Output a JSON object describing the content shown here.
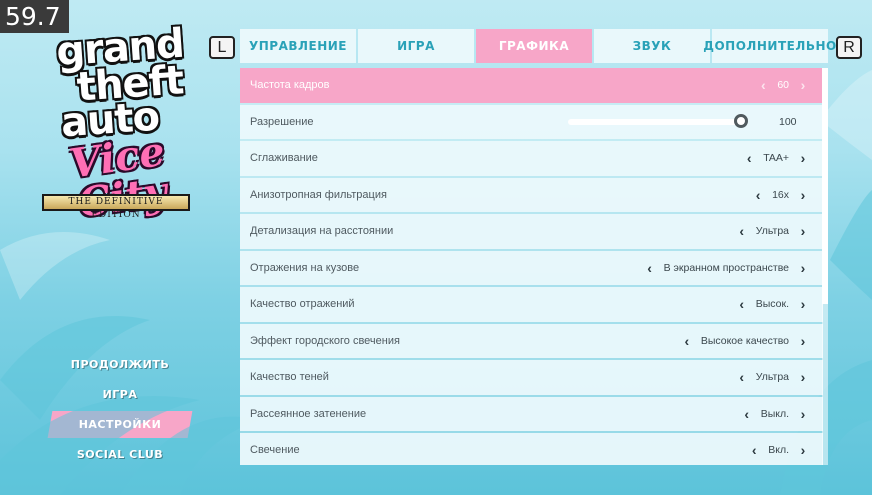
{
  "fps": "59.7",
  "logo": {
    "line1": "grand",
    "line2": "theft",
    "line3": "auto",
    "subtitle": "Vice City",
    "edition": "THE DEFINITIVE EDITION"
  },
  "shoulder_buttons": {
    "left": "L",
    "right": "R"
  },
  "tabs": [
    {
      "label": "управление",
      "active": false
    },
    {
      "label": "игра",
      "active": false
    },
    {
      "label": "графика",
      "active": true
    },
    {
      "label": "звук",
      "active": false
    },
    {
      "label": "дополнительно",
      "active": false
    }
  ],
  "settings": [
    {
      "label": "Частота кадров",
      "value": "60",
      "selected": true
    },
    {
      "label": "Разрешение",
      "value": "100",
      "slider_percent": 100
    },
    {
      "label": "Сглаживание",
      "value": "TAA+"
    },
    {
      "label": "Анизотропная фильтрация",
      "value": "16x"
    },
    {
      "label": "Детализация на расстоянии",
      "value": "Ультра"
    },
    {
      "label": "Отражения на кузове",
      "value": "В экранном пространстве"
    },
    {
      "label": "Качество отражений",
      "value": "Высок."
    },
    {
      "label": "Эффект городского свечения",
      "value": "Высокое качество"
    },
    {
      "label": "Качество теней",
      "value": "Ультра"
    },
    {
      "label": "Рассеянное затенение",
      "value": "Выкл."
    },
    {
      "label": "Свечение",
      "value": "Вкл."
    }
  ],
  "main_menu": [
    {
      "label": "продолжить",
      "active": false
    },
    {
      "label": "игра",
      "active": false
    },
    {
      "label": "настройки",
      "active": true
    },
    {
      "label": "social club",
      "active": false
    }
  ],
  "colors": {
    "accent_pink": "#f7a6c8",
    "tab_text": "#2aa2b8",
    "row_background": "#ecf9fc"
  },
  "arrows": {
    "left": "‹",
    "right": "›"
  }
}
